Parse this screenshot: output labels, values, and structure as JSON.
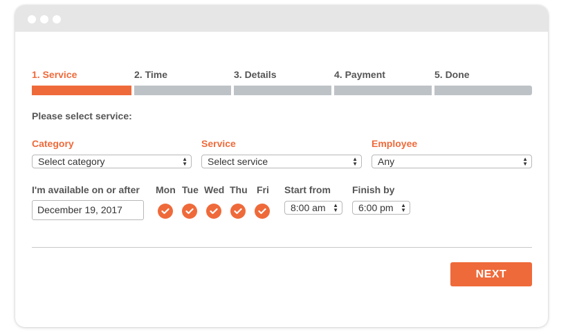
{
  "steps": [
    {
      "label": "1. Service"
    },
    {
      "label": "2. Time"
    },
    {
      "label": "3. Details"
    },
    {
      "label": "4. Payment"
    },
    {
      "label": "5. Done"
    }
  ],
  "active_step": 1,
  "prompt": "Please select service:",
  "fields": {
    "category": {
      "label": "Category",
      "value": "Select category"
    },
    "service": {
      "label": "Service",
      "value": "Select service"
    },
    "employee": {
      "label": "Employee",
      "value": "Any"
    }
  },
  "availability": {
    "label": "I'm available on or after",
    "date": "December 19, 2017"
  },
  "days": [
    "Mon",
    "Tue",
    "Wed",
    "Thu",
    "Fri"
  ],
  "start": {
    "label": "Start from",
    "value": "8:00 am"
  },
  "finish": {
    "label": "Finish by",
    "value": "6:00 pm"
  },
  "next_label": "NEXT",
  "colors": {
    "accent": "#ef6a3a",
    "inactive_bar": "#bdc2c6"
  },
  "icons": {
    "day_selected": "checkmark-icon",
    "select_arrows": "updown-arrows-icon"
  }
}
